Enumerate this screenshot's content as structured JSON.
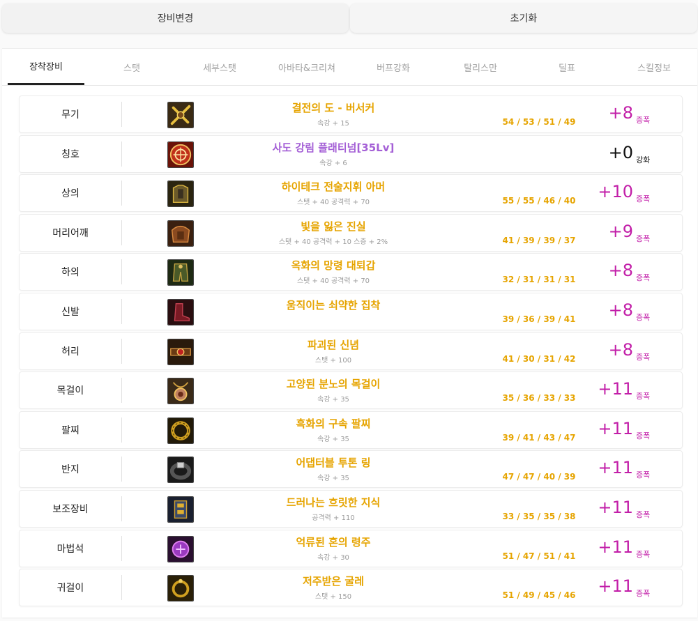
{
  "buttons": {
    "change_equipment": "장비변경",
    "reset": "초기화"
  },
  "tabs": [
    {
      "label": "장착장비",
      "active": true
    },
    {
      "label": "스탯",
      "active": false
    },
    {
      "label": "세부스탯",
      "active": false
    },
    {
      "label": "아바타&크리쳐",
      "active": false
    },
    {
      "label": "버프강화",
      "active": false
    },
    {
      "label": "탈리스만",
      "active": false
    },
    {
      "label": "딜표",
      "active": false
    },
    {
      "label": "스킬정보",
      "active": false
    }
  ],
  "colors": {
    "item_name_epic": "#e6a400",
    "item_name_purple": "#a45fd6",
    "amplify": "#c21ea8",
    "reinforce": "#111111"
  },
  "equipment": [
    {
      "slot": "무기",
      "icon": "weapon-icon",
      "name": "결전의 도 - 버서커",
      "name_color": "epic",
      "sub": "속강 + 15",
      "stats": "54 / 53 / 51 / 49",
      "level": "+8",
      "type": "증폭",
      "type_color": "amplify"
    },
    {
      "slot": "칭호",
      "icon": "title-icon",
      "name": "사도 강림 플래티넘[35Lv]",
      "name_color": "purple",
      "sub": "속강 + 6",
      "stats": "",
      "level": "+0",
      "type": "강화",
      "type_color": "reinforce"
    },
    {
      "slot": "상의",
      "icon": "top-armor-icon",
      "name": "하이테크 전술지휘 아머",
      "name_color": "epic",
      "sub": "스탯 + 40 공격력 + 70",
      "stats": "55 / 55 / 46 / 40",
      "level": "+10",
      "type": "증폭",
      "type_color": "amplify"
    },
    {
      "slot": "머리어깨",
      "icon": "shoulder-armor-icon",
      "name": "빛을 잃은 진실",
      "name_color": "epic",
      "sub": "스탯 + 40 공격력 + 10 스증 + 2%",
      "stats": "41 / 39 / 39 / 37",
      "level": "+9",
      "type": "증폭",
      "type_color": "amplify"
    },
    {
      "slot": "하의",
      "icon": "bottom-armor-icon",
      "name": "옥화의 망령 대퇴갑",
      "name_color": "epic",
      "sub": "스탯 + 40 공격력 + 70",
      "stats": "32 / 31 / 31 / 31",
      "level": "+8",
      "type": "증폭",
      "type_color": "amplify"
    },
    {
      "slot": "신발",
      "icon": "shoes-icon",
      "name": "움직이는 쇠약한 집착",
      "name_color": "epic",
      "sub": "",
      "stats": "39 / 36 / 39 / 41",
      "level": "+8",
      "type": "증폭",
      "type_color": "amplify"
    },
    {
      "slot": "허리",
      "icon": "belt-icon",
      "name": "파괴된 신념",
      "name_color": "epic",
      "sub": "스탯 + 100",
      "stats": "41 / 30 / 31 / 42",
      "level": "+8",
      "type": "증폭",
      "type_color": "amplify"
    },
    {
      "slot": "목걸이",
      "icon": "necklace-icon",
      "name": "고양된 분노의 목걸이",
      "name_color": "epic",
      "sub": "속강 + 35",
      "stats": "35 / 36 / 33 / 33",
      "level": "+11",
      "type": "증폭",
      "type_color": "amplify"
    },
    {
      "slot": "팔찌",
      "icon": "bracelet-icon",
      "name": "흑화의 구속 팔찌",
      "name_color": "epic",
      "sub": "속강 + 35",
      "stats": "39 / 41 / 43 / 47",
      "level": "+11",
      "type": "증폭",
      "type_color": "amplify"
    },
    {
      "slot": "반지",
      "icon": "ring-icon",
      "name": "어댑터블 투톤 링",
      "name_color": "epic",
      "sub": "속강 + 35",
      "stats": "47 / 47 / 40 / 39",
      "level": "+11",
      "type": "증폭",
      "type_color": "amplify"
    },
    {
      "slot": "보조장비",
      "icon": "subequip-icon",
      "name": "드러나는 흐릿한 지식",
      "name_color": "epic",
      "sub": "공격력 + 110",
      "stats": "33 / 35 / 35 / 38",
      "level": "+11",
      "type": "증폭",
      "type_color": "amplify"
    },
    {
      "slot": "마법석",
      "icon": "magic-stone-icon",
      "name": "억류된 혼의 령주",
      "name_color": "epic",
      "sub": "속강 + 30",
      "stats": "51 / 47 / 51 / 41",
      "level": "+11",
      "type": "증폭",
      "type_color": "amplify"
    },
    {
      "slot": "귀걸이",
      "icon": "earring-icon",
      "name": "저주받은 굴레",
      "name_color": "epic",
      "sub": "스탯 + 150",
      "stats": "51 / 49 / 45 / 46",
      "level": "+11",
      "type": "증폭",
      "type_color": "amplify"
    }
  ]
}
